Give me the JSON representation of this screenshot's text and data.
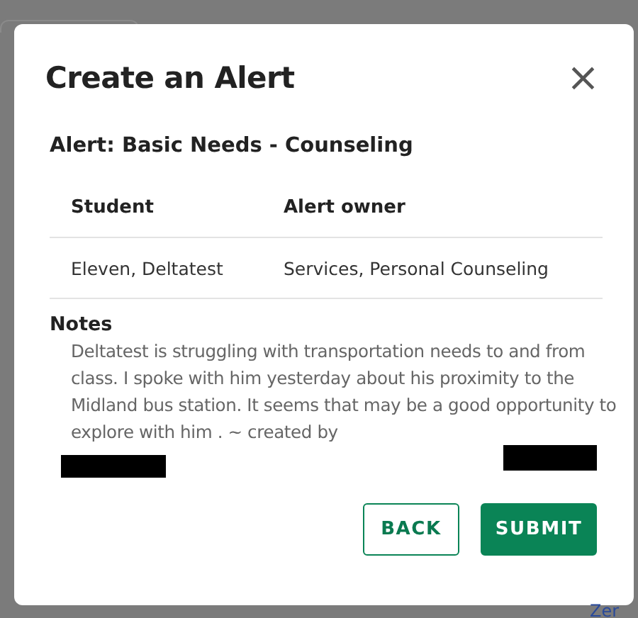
{
  "dialog": {
    "title": "Create an Alert",
    "close": "×",
    "alert_heading": "Alert: Basic Needs - Counseling",
    "table": {
      "columns": [
        "Student",
        "Alert owner"
      ],
      "rows": [
        [
          "Eleven, Deltatest",
          "Services, Personal Counseling"
        ]
      ]
    },
    "notes": {
      "label": "Notes",
      "text": "Deltatest is struggling with transportation needs to and from class. I spoke with him yesterday about his proximity to the Midland bus station. It seems that may be a good opportunity to explore with him . ~ created by"
    },
    "buttons": [
      {
        "label": "BACK",
        "kind": "secondary"
      },
      {
        "label": "SUBMIT",
        "kind": "primary"
      }
    ]
  },
  "background_link": "Zer"
}
